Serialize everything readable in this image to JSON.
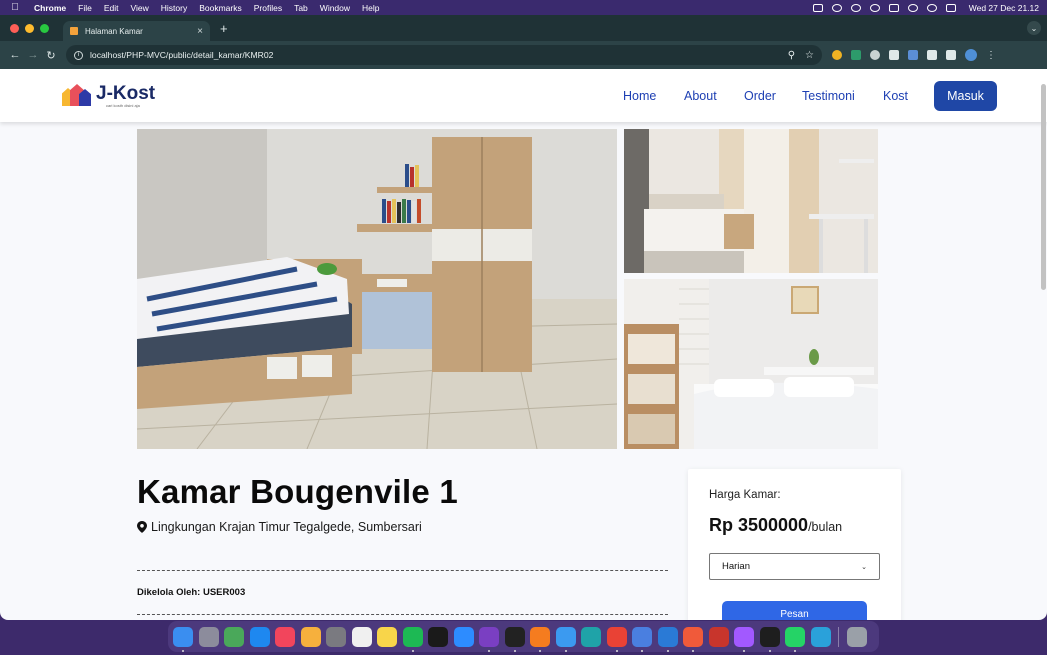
{
  "menubar": {
    "app_name": "Chrome",
    "items": [
      "File",
      "Edit",
      "View",
      "History",
      "Bookmarks",
      "Profiles",
      "Tab",
      "Window",
      "Help"
    ],
    "clock": "Wed 27 Dec  21.12"
  },
  "browser": {
    "tab_title": "Halaman Kamar",
    "tab_close": "×",
    "new_tab": "+",
    "url": "localhost/PHP-MVC/public/detail_kamar/KMR02"
  },
  "site": {
    "logo_name": "J-Kost",
    "logo_tagline": "cari kosth disini aja",
    "nav": {
      "home": "Home",
      "about": "About",
      "order": "Order",
      "testimoni": "Testimoni",
      "kost": "Kost"
    },
    "login_button": "Masuk"
  },
  "room": {
    "title": "Kamar Bougenvile 1",
    "location": "Lingkungan Krajan Timur Tegalgede, Sumbersari",
    "managed_by": "Dikelola Oleh: USER003"
  },
  "pricing": {
    "label": "Harga Kamar:",
    "price": "Rp 3500000",
    "unit": "/bulan",
    "period_selected": "Harian",
    "order_button": "Pesan"
  },
  "colors": {
    "brand_blue": "#1f47a6",
    "nav_link": "#1d3fb3",
    "order_button": "#2f67e6",
    "page_bg": "#f8f9fc"
  },
  "dock_apps": [
    {
      "icon": "finder-icon",
      "color": "#3a8ef0"
    },
    {
      "icon": "launchpad-icon",
      "color": "#8c8c9c"
    },
    {
      "icon": "maps-icon",
      "color": "#4aa85a"
    },
    {
      "icon": "app-store-icon",
      "color": "#1e88f0"
    },
    {
      "icon": "music-icon",
      "color": "#f2455c"
    },
    {
      "icon": "photos-icon",
      "color": "#f6b03d"
    },
    {
      "icon": "system-settings-icon",
      "color": "#7a7a80"
    },
    {
      "icon": "reminders-icon",
      "color": "#f0f0f0"
    },
    {
      "icon": "notes-icon",
      "color": "#f8d54a"
    },
    {
      "icon": "spotify-icon",
      "color": "#1db954"
    },
    {
      "icon": "apple-tv-icon",
      "color": "#1a1a1a"
    },
    {
      "icon": "zoom-icon",
      "color": "#2d8cff"
    },
    {
      "icon": "github-desktop-icon",
      "color": "#7a3fc2"
    },
    {
      "icon": "terminal-icon",
      "color": "#222222"
    },
    {
      "icon": "xampp-icon",
      "color": "#f57c1f"
    },
    {
      "icon": "safari-icon",
      "color": "#3b9af0"
    },
    {
      "icon": "edge-icon",
      "color": "#1fa3a8"
    },
    {
      "icon": "chrome-icon",
      "color": "#e94235"
    },
    {
      "icon": "postman-icon",
      "color": "#4a7fe0"
    },
    {
      "icon": "vscode-icon",
      "color": "#2a7ad6"
    },
    {
      "icon": "swift-icon",
      "color": "#f05a3a"
    },
    {
      "icon": "filezilla-icon",
      "color": "#c8352c"
    },
    {
      "icon": "figma-icon",
      "color": "#a259ff"
    },
    {
      "icon": "chatgpt-icon",
      "color": "#1e1e1e"
    },
    {
      "icon": "whatsapp-icon",
      "color": "#25d366"
    },
    {
      "icon": "telegram-icon",
      "color": "#2aa1da"
    },
    {
      "icon": "trash-icon",
      "color": "#9aa0a8"
    }
  ]
}
